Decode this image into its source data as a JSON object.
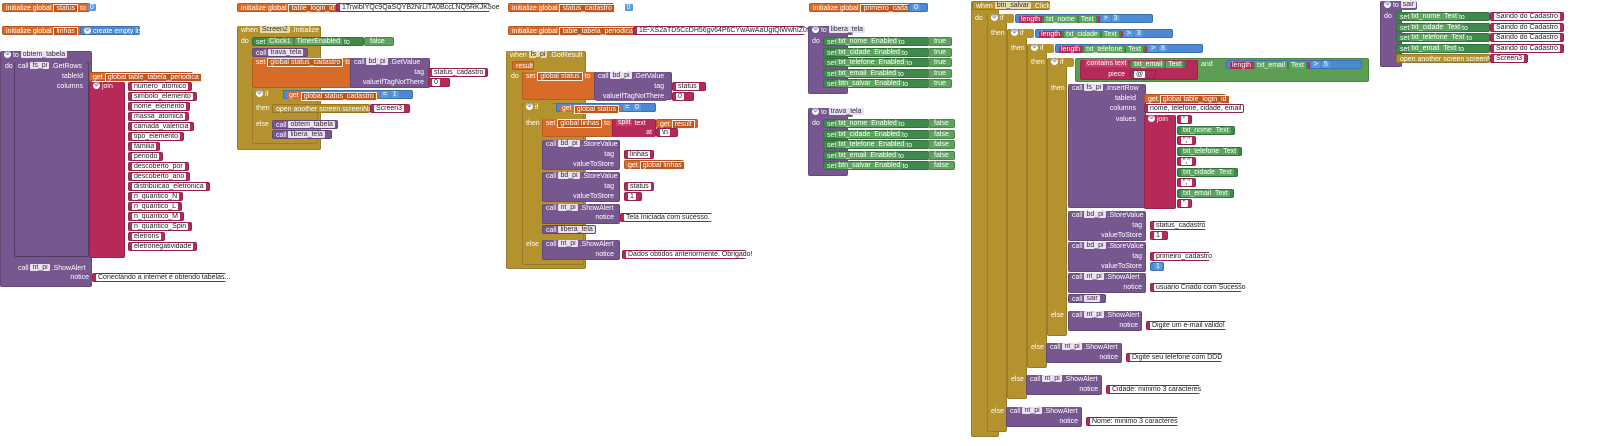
{
  "w1": {
    "status_init": {
      "kw": "initialize global",
      "var": "status",
      "to": "to",
      "val": "0"
    },
    "linhas_init": {
      "kw": "initialize global",
      "var": "linhas",
      "to": "to",
      "val": "create empty list"
    },
    "proc": {
      "kw": "to",
      "name": "obtem_tabela",
      "do": "do",
      "call": "call",
      "comp": "fs_pi",
      "method": ".GetRows",
      "tableId": "tableId",
      "get": "get",
      "get_var": "global table_tabela_periodica",
      "columns": "columns",
      "join": "join",
      "strings": [
        "numero_atomico",
        "simbolo_elemento",
        "nome_elemento",
        "massa_atomica",
        "camada_valencia",
        "tipo_elemento",
        "familia",
        "periodo",
        "descoberto_por",
        "descoberto_ano",
        "distribuicao_eletronica",
        "n_quantico_N",
        "n_quantico_L",
        "n_quantico_M",
        "n_quantico_Spin",
        "eletrons",
        "eletronegatividade"
      ],
      "call2": "call",
      "comp2": "nt_pi",
      "method2": ".ShowAlert",
      "notice": "notice",
      "notice_val": "Conectando a internet e obtendo tabelas..."
    }
  },
  "w2": {
    "init": {
      "kw": "initialize global",
      "var": "table_login_id",
      "to": "to",
      "val": "1TrwibIYQc9QaSQYB2NrLlTA0BccLNQ5RKJK5oe"
    },
    "event": {
      "when": "when",
      "comp": "Screen2",
      "evt": ".Initialize",
      "do": "do",
      "set": "set",
      "clock": "Clock1",
      "prop": "TimerEnabled",
      "to": "to",
      "bool": "false",
      "call_trava": "call",
      "trava": "trava_tela",
      "set2": "set",
      "gvar": "global status_cadastro",
      "to2": "to",
      "call3": "call",
      "comp3": "bd_pi",
      "getv": ".GetValue",
      "tag": "tag",
      "tag_val": "status_cadastro",
      "vifn": "valueIfTagNotThere",
      "vifn_val": "0",
      "if": "if",
      "get": "get",
      "get_var": "global status_cadastro",
      "eq": "=",
      "num": "1",
      "then": "then",
      "open": "open another screen  screenName",
      "scr": "Screen3",
      "else": "else",
      "call_obtem": "call",
      "obtem": "obtem_tabela",
      "call_libera": "call",
      "libera": "libera_tela"
    }
  },
  "w3": {
    "init1": {
      "kw": "initialize global",
      "var": "status_cadastro",
      "to": "to",
      "val": "0"
    },
    "init2": {
      "kw": "initialize global",
      "var": "table_tabela_periodica",
      "to": "to",
      "val": "1E-XS2aTD5CcDH56gv64P6CYwAwAaUgtQlWwhIZ09"
    },
    "event": {
      "when": "when",
      "comp": "fs_pi",
      "evt": ".GotResult",
      "result": "result",
      "do": "do",
      "set": "set",
      "gvar": "global status",
      "to": "to",
      "call": "call",
      "comp2": "bd_pi",
      "getv": ".GetValue",
      "tag": "tag",
      "tag_val": "status",
      "vifn": "valueIfTagNotThere",
      "vifn_val": "0",
      "if": "if",
      "get": "get",
      "get_var": "global status",
      "eq": "=",
      "num": "0",
      "then": "then",
      "set2": "set",
      "gvar2": "global linhas",
      "to2": "to",
      "split": "split",
      "text": "text",
      "get2": "get",
      "res": "result",
      "at": "at",
      "at_val": "\\n",
      "c1": "call",
      "c1comp": "bd_pi",
      "c1m": ".StoreValue",
      "c1tag": "tag",
      "c1tagv": "linhas",
      "c1vs": "valueToStore",
      "c1get": "get",
      "c1getv": "global linhas",
      "c2": "call",
      "c2comp": "bd_pi",
      "c2m": ".StoreValue",
      "c2tag": "tag",
      "c2tagv": "status",
      "c2vs": "valueToStore",
      "c2v": "1",
      "c3": "call",
      "c3comp": "nt_pi",
      "c3m": ".ShowAlert",
      "c3n": "notice",
      "c3v": "Tela Iniciada com sucesso.",
      "c4": "call",
      "c4v": "libera_tela",
      "else": "else",
      "c5": "call",
      "c5comp": "nt_pi",
      "c5m": ".ShowAlert",
      "c5n": "notice",
      "c5v": "Dados obtidos anteriormente. Obrigado!"
    }
  },
  "w4": {
    "init": {
      "kw": "initialize global",
      "var": "primeiro_cadastro",
      "to": "to",
      "val": "0"
    },
    "libera": {
      "to": "to",
      "name": "libera_tela",
      "do": "do",
      "rows": [
        {
          "comp": "txt_nome",
          "val": "true"
        },
        {
          "comp": "txt_cidade",
          "val": "true"
        },
        {
          "comp": "txt_telefone",
          "val": "true"
        },
        {
          "comp": "txt_email",
          "val": "true"
        },
        {
          "comp": "btn_salvar",
          "val": "true"
        }
      ],
      "set": "set",
      "prop": "Enabled",
      "to2": "to"
    },
    "trava": {
      "to": "to",
      "name": "trava_tela",
      "do": "do",
      "rows": [
        {
          "comp": "txt_nome",
          "val": "false"
        },
        {
          "comp": "txt_cidade",
          "val": "false"
        },
        {
          "comp": "txt_telefone",
          "val": "false"
        },
        {
          "comp": "txt_email",
          "val": "false"
        },
        {
          "comp": "btn_salvar",
          "val": "false"
        }
      ],
      "set": "set",
      "prop": "Enabled",
      "to2": "to"
    }
  },
  "w5": {
    "when": "when",
    "comp": "btn_salvar",
    "evt": ".Click",
    "do": "do",
    "if": "if",
    "length": "length",
    "text": "Text",
    "gt": ">",
    "c_nome": "txt_nome",
    "n_nome": "3",
    "c_cidade": "txt_cidade",
    "n_cidade": "3",
    "c_tel": "txt_telefone",
    "n_tel": "8",
    "contains": "contains text",
    "c_email": "txt_email",
    "piece": "piece",
    "at": "@",
    "and": "and",
    "n_email": "5",
    "then": "then",
    "call": "call",
    "fs": "fs_pi",
    "insert": ".InsertRow",
    "tableId": "tableId",
    "get": "get",
    "get_var": "global table_login_id",
    "columns": "columns",
    "cols_val": "nome, telefone, cidade, email",
    "values": "values",
    "join": "join",
    "quote": "\"",
    "comma": "\",\"",
    "bd": "bd_pi",
    "store": ".StoreValue",
    "tag": "tag",
    "vts": "valueToStore",
    "tag1": "status_cadastro",
    "v1": "1",
    "tag2": "primeiro_cadastro",
    "v2": "1",
    "nt": "nt_pi",
    "alert": ".ShowAlert",
    "notice": "notice",
    "msg_ok": "usuario Criado com Sucesso",
    "sair": "sair",
    "else": "else",
    "msg_email": "Digite um e-mail valido!",
    "msg_tel": "Digite seu telefone com DDD",
    "msg_cidade": "Cidade: minimo 3 caracteres",
    "msg_nome": "Nome: minimo 3 caracteres"
  },
  "w6": {
    "to": "to",
    "name": "sair",
    "do": "do",
    "set": "set",
    "text": "Text",
    "to2": "to",
    "rows": [
      {
        "comp": "txt_nome",
        "val": "Saindo do Cadastro"
      },
      {
        "comp": "txt_cidade",
        "val": "Saindo do Cadastro"
      },
      {
        "comp": "txt_telefone",
        "val": "Saindo do Cadastro"
      },
      {
        "comp": "txt_email",
        "val": "Saindo do Cadastro"
      }
    ],
    "open": "open another screen  screenName",
    "scr": "Screen3"
  },
  "colors": {
    "variables": "#d96b28",
    "control": "#b4922e",
    "procedures": "#76578f",
    "components": "#3f8a4a",
    "text": "#b52a59",
    "math": "#4c8ad6"
  }
}
